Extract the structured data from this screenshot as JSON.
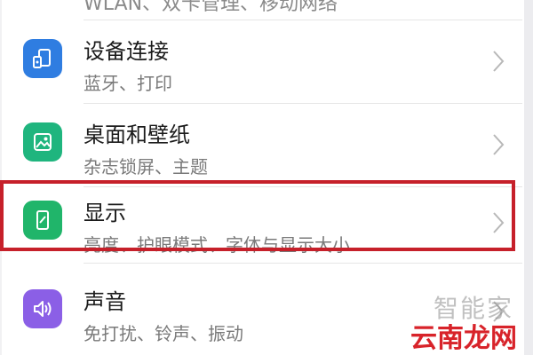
{
  "top_partial_text": "WLAN、双卡管理、移动网络",
  "settings": [
    {
      "title": "设备连接",
      "subtitle": "蓝牙、打印",
      "icon": "device-connection-icon",
      "color": "#2f7de1"
    },
    {
      "title": "桌面和壁纸",
      "subtitle": "杂志锁屏、主题",
      "icon": "wallpaper-icon",
      "color": "#1fb57e"
    },
    {
      "title": "显示",
      "subtitle": "亮度、护眼模式、字体与显示大小",
      "icon": "display-icon",
      "color": "#20b56a"
    },
    {
      "title": "声音",
      "subtitle": "免打扰、铃声、振动",
      "icon": "sound-icon",
      "color": "#8b5fe6"
    }
  ],
  "highlight_color": "#c6202a",
  "watermark": {
    "primary": "云南龙网",
    "secondary": "智能家"
  }
}
